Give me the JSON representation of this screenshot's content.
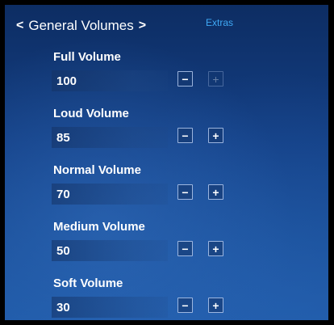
{
  "header": {
    "back_arrow": "<",
    "title": "General Volumes",
    "forward_arrow": ">",
    "extras_tab": "Extras"
  },
  "settings": [
    {
      "label": "Full Volume",
      "value": "100",
      "minus": "−",
      "plus": "+",
      "plus_disabled": true
    },
    {
      "label": "Loud Volume",
      "value": "85",
      "minus": "−",
      "plus": "+"
    },
    {
      "label": "Normal Volume",
      "value": "70",
      "minus": "−",
      "plus": "+"
    },
    {
      "label": "Medium Volume",
      "value": "50",
      "minus": "−",
      "plus": "+"
    },
    {
      "label": "Soft Volume",
      "value": "30",
      "minus": "−",
      "plus": "+"
    }
  ],
  "colors": {
    "accent_tab": "#3fa9f5",
    "background_top": "#0d2d63",
    "background_bottom": "#1f5aa8"
  }
}
